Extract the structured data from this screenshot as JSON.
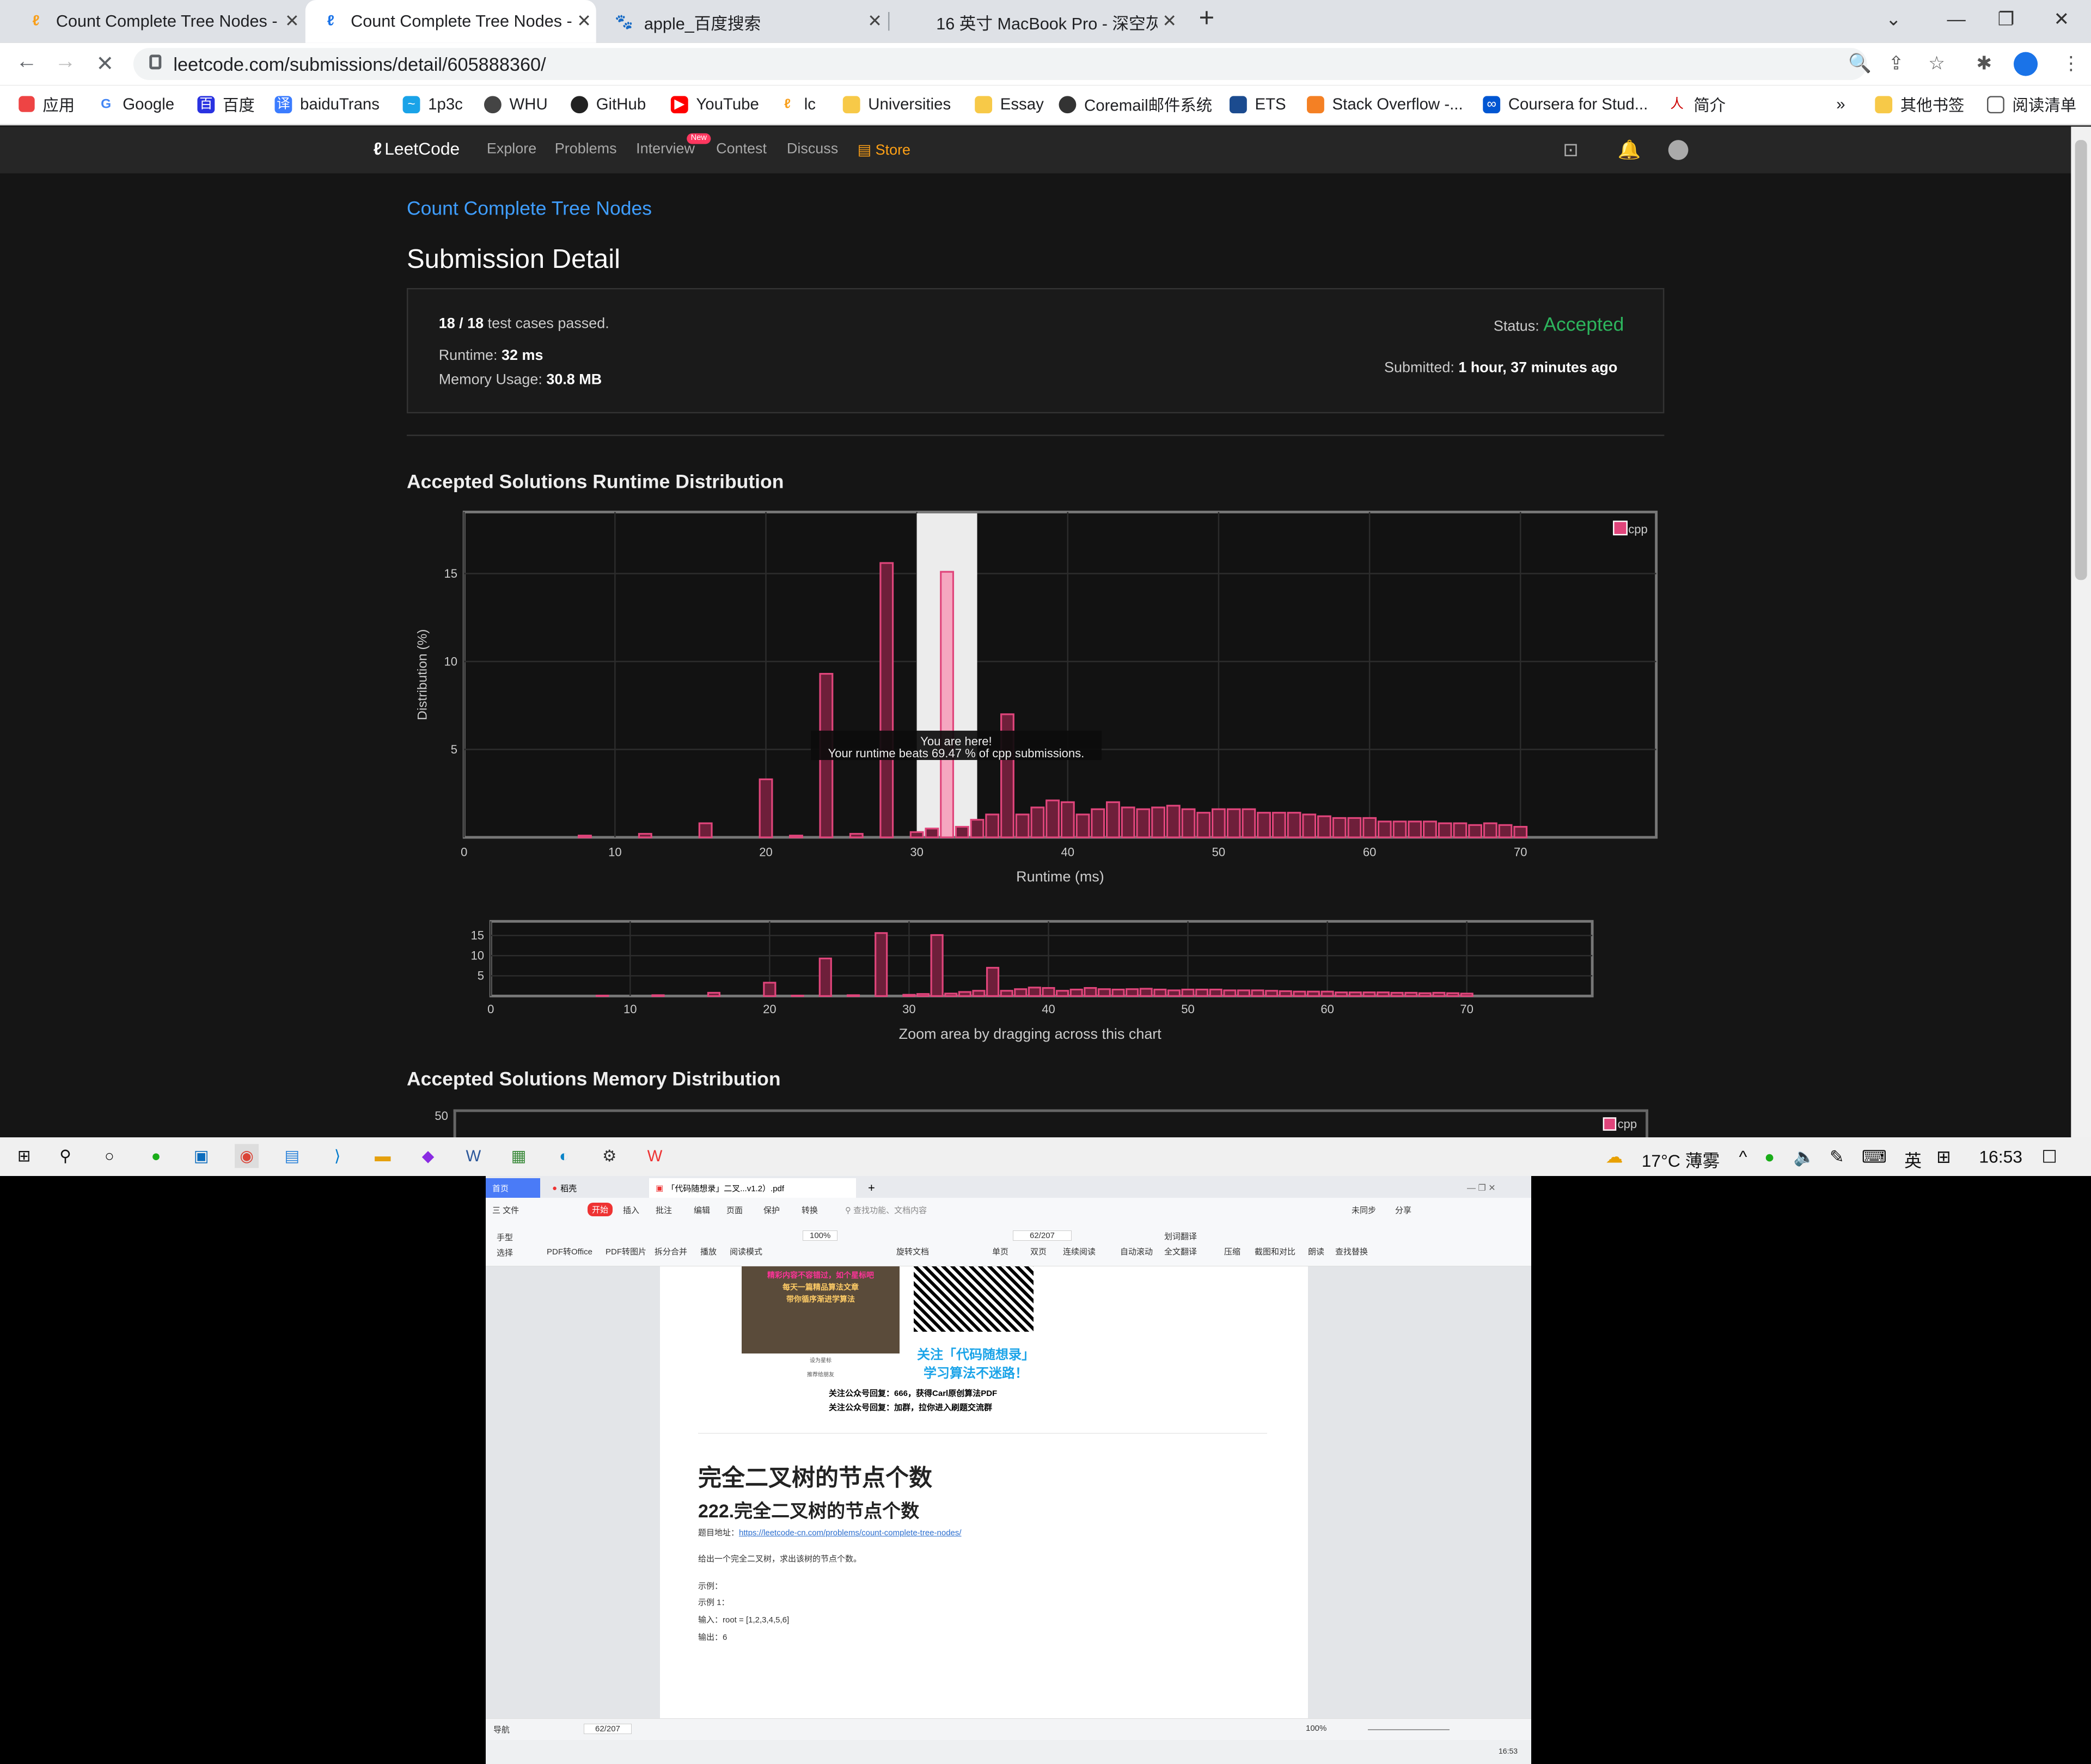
{
  "browser": {
    "tabs": [
      {
        "title": "Count Complete Tree Nodes -",
        "active": false
      },
      {
        "title": "Count Complete Tree Nodes -",
        "active": true
      },
      {
        "title": "apple_百度搜索",
        "active": false
      },
      {
        "title": "16 英寸 MacBook Pro - 深空灰",
        "active": false
      }
    ],
    "url": "leetcode.com/submissions/detail/605888360/",
    "bookmarks": [
      "应用",
      "Google",
      "百度",
      "baiduTrans",
      "1p3c",
      "WHU",
      "GitHub",
      "YouTube",
      "lc",
      "Universities",
      "Essay",
      "Coremail邮件系统",
      "ETS",
      "Stack Overflow -...",
      "Coursera for Stud...",
      "简介"
    ],
    "bookmarks_more": "»",
    "other_bookmarks": "其他书签",
    "reading_list": "阅读清单"
  },
  "leetcode": {
    "logo": "LeetCode",
    "nav": [
      "Explore",
      "Problems",
      "Interview",
      "Contest",
      "Discuss",
      "Store"
    ],
    "new_badge": "New",
    "problem_link": "Count Complete Tree Nodes",
    "heading": "Submission Detail",
    "tests_passed": "18 / 18",
    "tests_suffix": "test cases passed.",
    "runtime_label": "Runtime:",
    "runtime": "32 ms",
    "memory_label": "Memory Usage:",
    "memory": "30.8 MB",
    "status_label": "Status:",
    "status": "Accepted",
    "submitted_label": "Submitted:",
    "submitted": "1 hour, 37 minutes ago",
    "runtime_section": "Accepted Solutions Runtime Distribution",
    "memory_section": "Accepted Solutions Memory Distribution",
    "zoom_hint": "Zoom area by dragging across this chart",
    "tooltip_line1": "You are here!",
    "tooltip_line2": "Your runtime beats 69.47 % of cpp submissions.",
    "memory_y_tick": "50",
    "colors": {
      "accent": "#3f9eff",
      "accepted": "#2db55d",
      "bar": "#e0457b",
      "store": "#ffa116"
    }
  },
  "chart_data": [
    {
      "type": "bar",
      "title": "Accepted Solutions Runtime Distribution",
      "xlabel": "Runtime (ms)",
      "ylabel": "Distribution (%)",
      "legend": "cpp",
      "legend_position": "top-right",
      "xlim": [
        0,
        79
      ],
      "ylim": [
        0,
        18.5
      ],
      "xticks": [
        0,
        10,
        20,
        30,
        40,
        50,
        60,
        70
      ],
      "yticks": [
        5,
        10,
        15
      ],
      "highlight_x": 32,
      "highlight_range": [
        30,
        34
      ],
      "x": [
        8,
        12,
        16,
        20,
        22,
        24,
        26,
        28,
        30,
        31,
        32,
        33,
        34,
        35,
        36,
        37,
        38,
        39,
        40,
        41,
        42,
        43,
        44,
        45,
        46,
        47,
        48,
        49,
        50,
        51,
        52,
        53,
        54,
        55,
        56,
        57,
        58,
        59,
        60,
        61,
        62,
        63,
        64,
        65,
        66,
        67,
        68,
        69,
        70
      ],
      "values": [
        0.1,
        0.2,
        0.8,
        3.3,
        0.1,
        9.3,
        0.2,
        15.6,
        0.3,
        0.5,
        15.1,
        0.6,
        1.0,
        1.3,
        7.0,
        1.3,
        1.7,
        2.1,
        2.0,
        1.3,
        1.6,
        2.0,
        1.7,
        1.6,
        1.7,
        1.8,
        1.6,
        1.4,
        1.6,
        1.6,
        1.6,
        1.4,
        1.4,
        1.4,
        1.3,
        1.2,
        1.1,
        1.1,
        1.1,
        0.9,
        0.9,
        0.9,
        0.9,
        0.8,
        0.8,
        0.7,
        0.8,
        0.7,
        0.6
      ]
    },
    {
      "type": "bar",
      "title": "",
      "xlim": [
        0,
        79
      ],
      "ylim": [
        0,
        18.5
      ],
      "xticks": [
        0,
        10,
        20,
        30,
        40,
        50,
        60,
        70
      ],
      "yticks": [
        5,
        10,
        15
      ],
      "x": [
        8,
        12,
        16,
        20,
        22,
        24,
        26,
        28,
        30,
        31,
        32,
        33,
        34,
        35,
        36,
        37,
        38,
        39,
        40,
        41,
        42,
        43,
        44,
        45,
        46,
        47,
        48,
        49,
        50,
        51,
        52,
        53,
        54,
        55,
        56,
        57,
        58,
        59,
        60,
        61,
        62,
        63,
        64,
        65,
        66,
        67,
        68,
        69,
        70
      ],
      "values": [
        0.1,
        0.2,
        0.8,
        3.3,
        0.1,
        9.3,
        0.2,
        15.6,
        0.3,
        0.5,
        15.1,
        0.6,
        1.0,
        1.3,
        7.0,
        1.3,
        1.7,
        2.1,
        2.0,
        1.3,
        1.6,
        2.0,
        1.7,
        1.6,
        1.7,
        1.8,
        1.6,
        1.4,
        1.6,
        1.6,
        1.6,
        1.4,
        1.4,
        1.4,
        1.3,
        1.2,
        1.1,
        1.1,
        1.1,
        0.9,
        0.9,
        0.9,
        0.9,
        0.8,
        0.8,
        0.7,
        0.8,
        0.7,
        0.6
      ]
    }
  ],
  "taskbar": {
    "weather": "17°C 薄雾",
    "ime": "英",
    "time": "16:53"
  },
  "wps": {
    "tabs": [
      "首页",
      "稻壳",
      "「代码随想录」二叉...v1.2）.pdf"
    ],
    "menus": [
      "三 文件",
      "开始",
      "插入",
      "批注",
      "编辑",
      "页面",
      "保护",
      "转换"
    ],
    "search": "查找功能、文档内容",
    "sync": "未同步",
    "share": "分享",
    "tools": [
      "手型",
      "选择",
      "PDF转Office",
      "PDF转图片",
      "拆分合并",
      "播放",
      "阅读模式",
      "旋转文档",
      "单页",
      "双页",
      "连续阅读",
      "自动滚动",
      "划词翻译",
      "全文翻译",
      "压缩",
      "截图和对比",
      "朗读",
      "查找替换"
    ],
    "zoom": "100%",
    "page_box": "62/207",
    "qr_caption1": "关注「代码随想录」",
    "qr_caption2": "学习算法不迷路！",
    "promo1": "精彩内容不容错过，如个星标吧",
    "promo2": "每天一篇精品算法文章",
    "promo3": "带你循序渐进学算法",
    "promo_small1": "设为星标",
    "promo_small2": "推荐给朋友",
    "note1": "关注公众号回复：666，获得Carl原创算法PDF",
    "note2": "关注公众号回复：加群，拉你进入刷题交流群",
    "h1": "完全二叉树的节点个数",
    "h2": "222.完全二叉树的节点个数",
    "addr_label": "题目地址：",
    "addr_link": "https://leetcode-cn.com/problems/count-complete-tree-nodes/",
    "desc": "给出一个完全二叉树，求出该树的节点个数。",
    "ex_label": "示例：",
    "ex1": "示例 1：",
    "input": "输入：root = [1,2,3,4,5,6]",
    "output": "输出：6",
    "status_nav": "导航",
    "status_page": "62/207",
    "status_zoom": "100%",
    "task_time": "16:53"
  }
}
